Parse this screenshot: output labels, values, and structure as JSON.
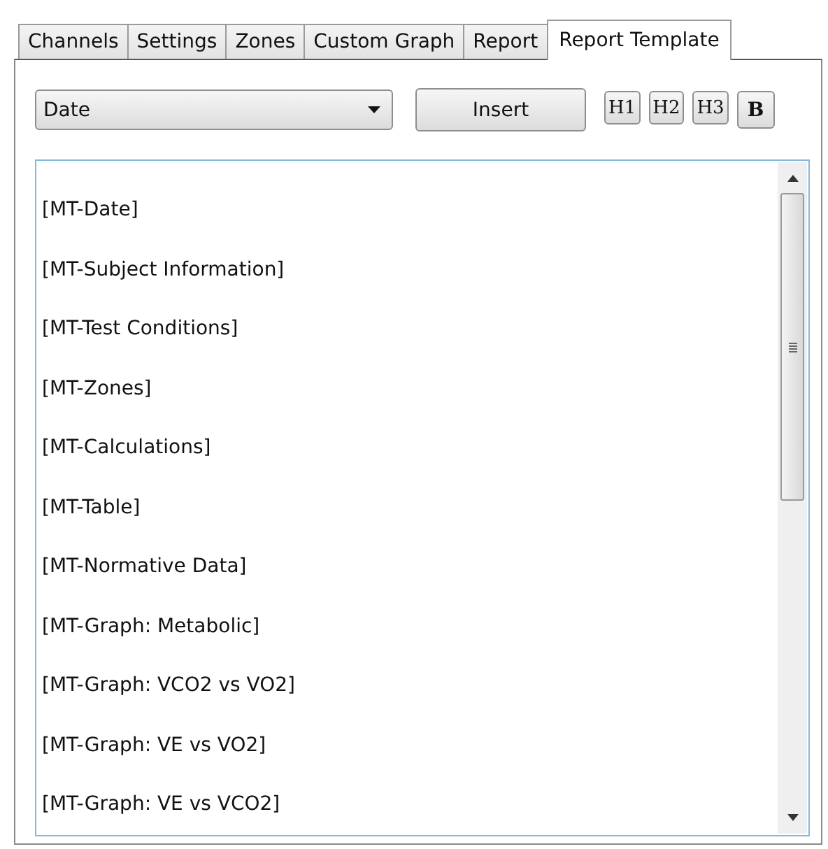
{
  "tabs": [
    {
      "label": "Channels",
      "selected": false
    },
    {
      "label": "Settings",
      "selected": false
    },
    {
      "label": "Zones",
      "selected": false
    },
    {
      "label": "Custom Graph",
      "selected": false
    },
    {
      "label": "Report",
      "selected": false
    },
    {
      "label": "Report Template",
      "selected": true
    }
  ],
  "toolbar": {
    "field_dropdown": {
      "value": "Date"
    },
    "insert_button": "Insert",
    "format_buttons": [
      {
        "label": "H1",
        "kind": "heading"
      },
      {
        "label": "H2",
        "kind": "heading"
      },
      {
        "label": "H3",
        "kind": "heading"
      },
      {
        "label": "B",
        "kind": "bold"
      }
    ]
  },
  "editor": {
    "lines": [
      "[MT-Date]",
      "[MT-Subject Information]",
      "[MT-Test Conditions]",
      "[MT-Zones]",
      "[MT-Calculations]",
      "[MT-Table]",
      "[MT-Normative Data]",
      "[MT-Graph: Metabolic]",
      "[MT-Graph: VCO2 vs VO2]",
      "[MT-Graph: VE vs VO2]",
      "[MT-Graph: VE vs VCO2]"
    ]
  }
}
